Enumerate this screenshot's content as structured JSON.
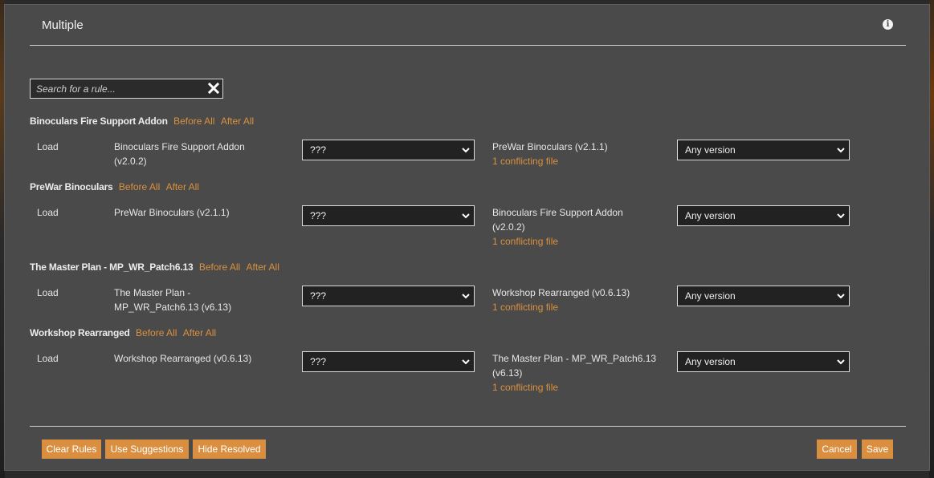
{
  "dialog": {
    "title": "Multiple",
    "info_icon": "info-icon"
  },
  "search": {
    "placeholder": "Search for a rule...",
    "clear_icon": "close-icon"
  },
  "groups": [
    {
      "name": "Binoculars Fire Support Addon",
      "before_all": "Before All",
      "after_all": "After All",
      "rule": {
        "action": "Load",
        "mod": "Binoculars Fire Support Addon (v2.0.2)",
        "relation": "???",
        "reference": "PreWar Binoculars (v2.1.1)",
        "conflict": "1 conflicting file",
        "version": "Any version"
      }
    },
    {
      "name": "PreWar Binoculars",
      "before_all": "Before All",
      "after_all": "After All",
      "rule": {
        "action": "Load",
        "mod": "PreWar Binoculars (v2.1.1)",
        "relation": "???",
        "reference": "Binoculars Fire Support Addon (v2.0.2)",
        "conflict": "1 conflicting file",
        "version": "Any version"
      }
    },
    {
      "name": "The Master Plan - MP_WR_Patch6.13",
      "before_all": "Before All",
      "after_all": "After All",
      "rule": {
        "action": "Load",
        "mod": "The Master Plan - MP_WR_Patch6.13 (v6.13)",
        "relation": "???",
        "reference": "Workshop Rearranged (v0.6.13)",
        "conflict": "1 conflicting file",
        "version": "Any version"
      }
    },
    {
      "name": "Workshop Rearranged",
      "before_all": "Before All",
      "after_all": "After All",
      "rule": {
        "action": "Load",
        "mod": "Workshop Rearranged (v0.6.13)",
        "relation": "???",
        "reference": "The Master Plan - MP_WR_Patch6.13 (v6.13)",
        "conflict": "1 conflicting file",
        "version": "Any version"
      }
    }
  ],
  "footer": {
    "clear_rules": "Clear Rules",
    "use_suggestions": "Use Suggestions",
    "hide_resolved": "Hide Resolved",
    "cancel": "Cancel",
    "save": "Save"
  },
  "colors": {
    "accent": "#d9913e",
    "dialog_bg": "#4a4a4a",
    "input_bg": "#222222"
  }
}
